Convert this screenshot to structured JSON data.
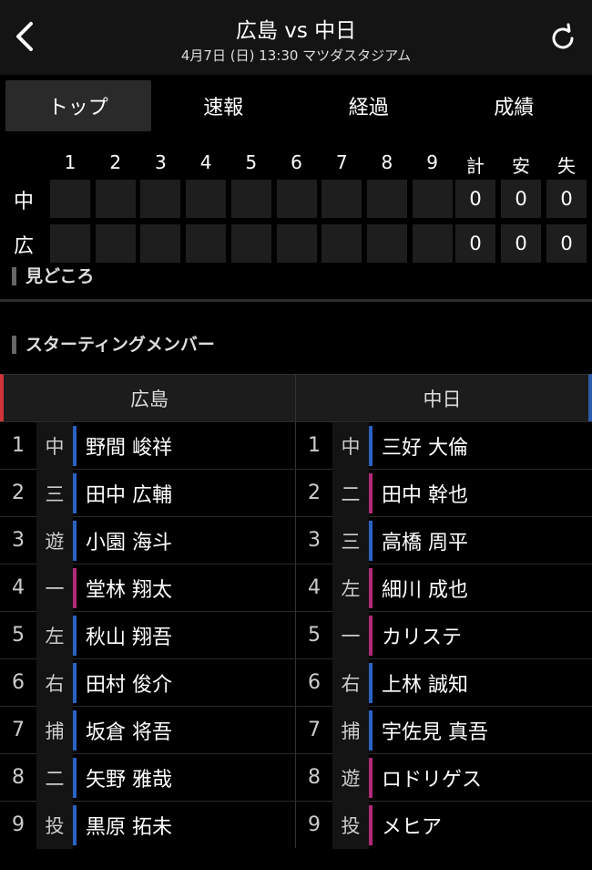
{
  "header": {
    "title": "広島 vs 中日",
    "subtitle": "4月7日 (日) 13:30 マツダスタジアム"
  },
  "tabs": [
    {
      "label": "トップ",
      "active": true
    },
    {
      "label": "速報",
      "active": false
    },
    {
      "label": "経過",
      "active": false
    },
    {
      "label": "成績",
      "active": false
    }
  ],
  "scoreboard": {
    "innings": [
      "1",
      "2",
      "3",
      "4",
      "5",
      "6",
      "7",
      "8",
      "9"
    ],
    "totals_labels": [
      "計",
      "安",
      "失"
    ],
    "teams": [
      {
        "label": "中",
        "totals": [
          "0",
          "0",
          "0"
        ]
      },
      {
        "label": "広",
        "totals": [
          "0",
          "0",
          "0"
        ]
      }
    ]
  },
  "sections": {
    "highlights": "見どころ",
    "starting": "スターティングメンバー"
  },
  "lineup": {
    "home_team": "広島",
    "away_team": "中日",
    "home": [
      {
        "num": "1",
        "pos": "中",
        "name": "野間 峻祥",
        "hand": "blue"
      },
      {
        "num": "2",
        "pos": "三",
        "name": "田中 広輔",
        "hand": "blue"
      },
      {
        "num": "3",
        "pos": "遊",
        "name": "小園 海斗",
        "hand": "blue"
      },
      {
        "num": "4",
        "pos": "一",
        "name": "堂林 翔太",
        "hand": "pink"
      },
      {
        "num": "5",
        "pos": "左",
        "name": "秋山 翔吾",
        "hand": "blue"
      },
      {
        "num": "6",
        "pos": "右",
        "name": "田村 俊介",
        "hand": "blue"
      },
      {
        "num": "7",
        "pos": "捕",
        "name": "坂倉 将吾",
        "hand": "blue"
      },
      {
        "num": "8",
        "pos": "二",
        "name": "矢野 雅哉",
        "hand": "blue"
      },
      {
        "num": "9",
        "pos": "投",
        "name": "黒原 拓未",
        "hand": "blue"
      }
    ],
    "away": [
      {
        "num": "1",
        "pos": "中",
        "name": "三好 大倫",
        "hand": "blue"
      },
      {
        "num": "2",
        "pos": "二",
        "name": "田中 幹也",
        "hand": "pink"
      },
      {
        "num": "3",
        "pos": "三",
        "name": "高橋 周平",
        "hand": "blue"
      },
      {
        "num": "4",
        "pos": "左",
        "name": "細川 成也",
        "hand": "pink"
      },
      {
        "num": "5",
        "pos": "一",
        "name": "カリステ",
        "hand": "pink"
      },
      {
        "num": "6",
        "pos": "右",
        "name": "上林 誠知",
        "hand": "blue"
      },
      {
        "num": "7",
        "pos": "捕",
        "name": "宇佐見 真吾",
        "hand": "blue"
      },
      {
        "num": "8",
        "pos": "遊",
        "name": "ロドリゲス",
        "hand": "pink"
      },
      {
        "num": "9",
        "pos": "投",
        "name": "メヒア",
        "hand": "pink"
      }
    ]
  },
  "colors": {
    "home_accent": "#d0343a",
    "away_accent": "#2a5cab",
    "hand_blue": "#2a63c0",
    "hand_pink": "#b02a78"
  }
}
